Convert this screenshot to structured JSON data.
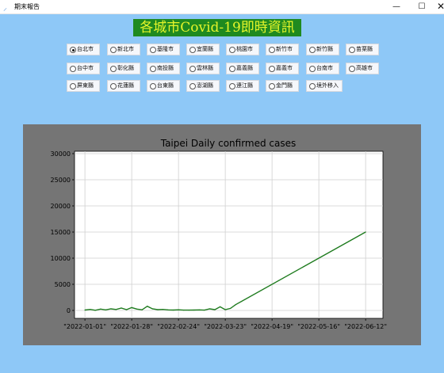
{
  "window": {
    "title": "期末報告",
    "controls": {
      "minimize": "—",
      "maximize": "☐",
      "close": "✕"
    }
  },
  "banner": {
    "text": "各城市Covid-19即時資訊"
  },
  "cities": [
    {
      "label": "台北市",
      "selected": true
    },
    {
      "label": "新北市",
      "selected": false
    },
    {
      "label": "基隆市",
      "selected": false
    },
    {
      "label": "宜蘭縣",
      "selected": false
    },
    {
      "label": "桃園市",
      "selected": false
    },
    {
      "label": "新竹市",
      "selected": false
    },
    {
      "label": "新竹縣",
      "selected": false
    },
    {
      "label": "苗栗縣",
      "selected": false
    },
    {
      "label": "台中市",
      "selected": false
    },
    {
      "label": "彰化縣",
      "selected": false
    },
    {
      "label": "南投縣",
      "selected": false
    },
    {
      "label": "雲林縣",
      "selected": false
    },
    {
      "label": "嘉義縣",
      "selected": false
    },
    {
      "label": "嘉義市",
      "selected": false
    },
    {
      "label": "台南市",
      "selected": false
    },
    {
      "label": "高雄市",
      "selected": false
    },
    {
      "label": "屏東縣",
      "selected": false
    },
    {
      "label": "花蓮縣",
      "selected": false
    },
    {
      "label": "台東縣",
      "selected": false
    },
    {
      "label": "澎湖縣",
      "selected": false
    },
    {
      "label": "連江縣",
      "selected": false
    },
    {
      "label": "金門縣",
      "selected": false
    },
    {
      "label": "境外移入",
      "selected": false
    }
  ],
  "colors": {
    "background": "#8ec8f7",
    "banner_bg": "#1f8a1f",
    "banner_text": "#e5f52a",
    "chart_panel": "#757575",
    "line": "#1e7b1e"
  },
  "chart_data": {
    "type": "line",
    "title": "Taipei Daily confirmed cases",
    "xlabel": "",
    "ylabel": "",
    "ylim": [
      0,
      30000
    ],
    "yticks": [
      0,
      5000,
      10000,
      15000,
      20000,
      25000,
      30000
    ],
    "xticks": [
      "\"2022-01-01\"",
      "\"2022-01-28\"",
      "\"2022-02-24\"",
      "\"2022-03-23\"",
      "\"2022-04-19\"",
      "\"2022-05-16\"",
      "\"2022-06-12\""
    ],
    "grid": true,
    "series": [
      {
        "x": [
          "2022-01-01",
          "2022-01-04",
          "2022-01-07",
          "2022-01-10",
          "2022-01-13",
          "2022-01-16",
          "2022-01-19",
          "2022-01-22",
          "2022-01-25",
          "2022-01-28",
          "2022-01-31",
          "2022-02-03",
          "2022-02-06",
          "2022-02-09",
          "2022-02-12",
          "2022-02-15",
          "2022-02-18",
          "2022-02-21",
          "2022-02-24",
          "2022-02-27",
          "2022-03-02",
          "2022-03-05",
          "2022-03-08",
          "2022-03-11",
          "2022-03-14",
          "2022-03-17",
          "2022-03-20",
          "2022-03-23",
          "2022-03-26",
          "2022-03-29",
          "2022-06-12"
        ],
        "values": [
          80,
          200,
          30,
          250,
          100,
          300,
          180,
          450,
          150,
          550,
          250,
          120,
          800,
          300,
          150,
          200,
          100,
          80,
          120,
          60,
          60,
          80,
          100,
          60,
          300,
          150,
          700,
          150,
          400,
          1100,
          15000
        ]
      }
    ]
  }
}
